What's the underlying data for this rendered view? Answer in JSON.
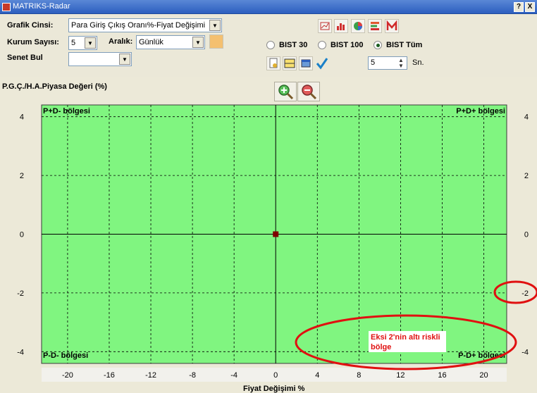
{
  "window": {
    "title": "MATRIKS-Radar",
    "help_label": "?",
    "close_label": "X"
  },
  "controls": {
    "chart_type_label": "Grafik Cinsi:",
    "chart_type_value": "Para Giriş Çıkış Oranı%-Fiyat Değişimi",
    "count_label": "Kurum Sayısı:",
    "count_value": "5",
    "interval_label": "Aralık:",
    "interval_value": "Günlük",
    "find_label": "Senet Bul",
    "find_value": "",
    "radio_options": [
      {
        "label": "BIST 30",
        "selected": false
      },
      {
        "label": "BIST 100",
        "selected": false
      },
      {
        "label": "BIST Tüm",
        "selected": true
      }
    ],
    "seconds_value": "5",
    "seconds_unit": "Sn.",
    "toolbar_icons": [
      "chart-icon",
      "bar-chart-icon",
      "pie-chart-icon",
      "list-icon",
      "mail-icon"
    ],
    "action_icons": [
      "report-icon",
      "table-icon",
      "window-icon",
      "check-icon"
    ]
  },
  "chart_data": {
    "type": "scatter",
    "xlabel": "Fiyat Değişimi %",
    "ylabel": "P.G.Ç./H.A.Piyasa Değeri (%)",
    "xlim": [
      -22.5,
      22.2
    ],
    "ylim": [
      -4.4,
      4.4
    ],
    "x_ticks": [
      -20,
      -16,
      -12,
      -8,
      -4,
      0,
      4,
      8,
      12,
      16,
      20
    ],
    "y_ticks": [
      4,
      2,
      0,
      -2,
      -4
    ],
    "x_tick_labels": [
      "-20",
      "-16",
      "-12",
      "-8",
      "-4",
      "0",
      "4",
      "8",
      "12",
      "16",
      "20"
    ],
    "y_tick_labels": [
      "4",
      "2",
      "0",
      "-2",
      "-4"
    ],
    "points": [
      {
        "x": 0,
        "y": 0
      }
    ],
    "grid": true,
    "background": "#80f580",
    "point_color": "#800000",
    "quadrant_labels": {
      "top_left": "P+D- bölgesi",
      "top_right": "P+D+ bölgesi",
      "bottom_left": "P-D- bölgesi",
      "bottom_right": "P-D+ bölgesi"
    },
    "annotation": {
      "text_line1": "Eksi 2'nin altı riskli",
      "text_line2": "bölge",
      "color": "#e01010"
    }
  }
}
